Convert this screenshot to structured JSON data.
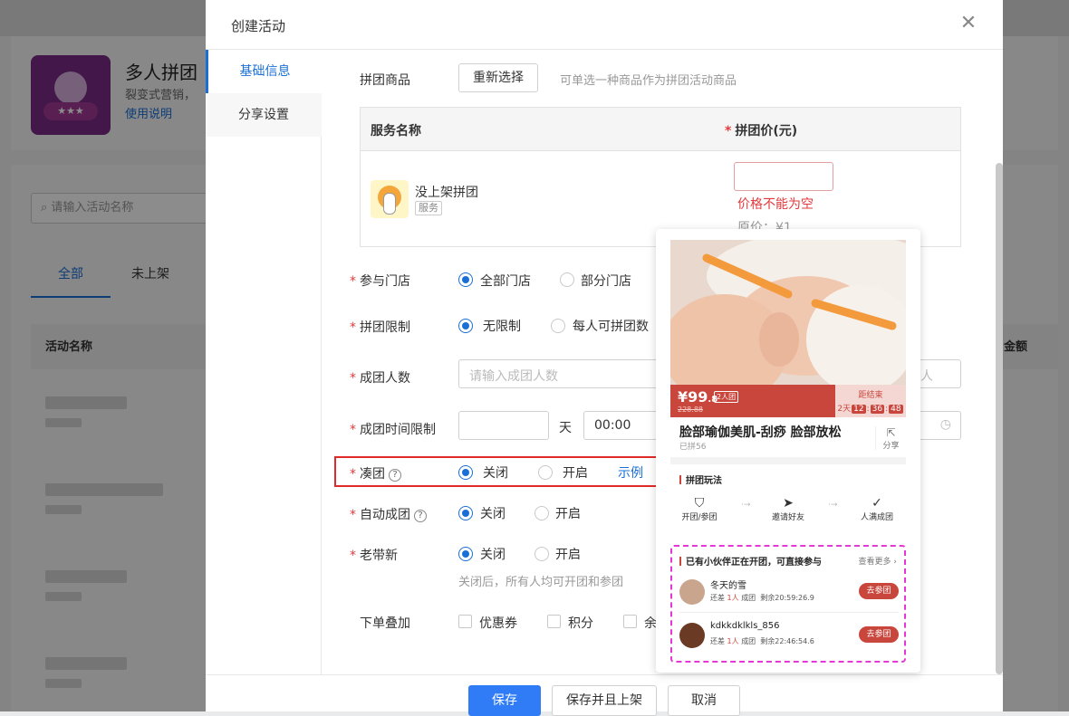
{
  "background": {
    "app_title": "多人拼团",
    "app_desc": "裂变式营销，",
    "app_link": "使用说明",
    "search_placeholder": "请输入活动名称",
    "tabs": [
      "全部",
      "未上架"
    ],
    "col_name": "活动名称",
    "col_amount": "金额"
  },
  "modal": {
    "title": "创建活动",
    "close": "✕",
    "side_tabs": [
      "基础信息",
      "分享设置"
    ],
    "product": {
      "label": "拼团商品",
      "reselect": "重新选择",
      "hint": "可单选一种商品作为拼团活动商品",
      "col_service": "服务名称",
      "col_price": "拼团价(元)",
      "item_name": "没上架拼团",
      "item_tag": "服务",
      "price_error": "价格不能为空",
      "orig_price": "原价：¥1"
    },
    "stores": {
      "label": "参与门店",
      "opt1": "全部门店",
      "opt2": "部分门店"
    },
    "limit": {
      "label": "拼团限制",
      "opt1": "无限制",
      "opt2": "每人可拼团数"
    },
    "size": {
      "label": "成团人数",
      "placeholder": "请输入成团人数",
      "unit": "人"
    },
    "time": {
      "label": "成团时间限制",
      "day_unit": "天",
      "time_value": "00:00"
    },
    "combine": {
      "label": "凑团",
      "opt1": "关闭",
      "opt2": "开启",
      "example": "示例"
    },
    "auto": {
      "label": "自动成团",
      "opt1": "关闭",
      "opt2": "开启"
    },
    "oldnew": {
      "label": "老带新",
      "opt1": "关闭",
      "opt2": "开启",
      "note": "关闭后，所有人均可开团和参团"
    },
    "stack": {
      "label": "下单叠加",
      "opt1": "优惠券",
      "opt2": "积分",
      "opt3": "余"
    },
    "buttons": {
      "save": "保存",
      "save_publish": "保存并且上架",
      "cancel": "取消"
    }
  },
  "preview": {
    "price": "¥99",
    "price_decimal": ".8",
    "orig": "228.88",
    "group_badge": "2人团",
    "countdown_label": "距结束",
    "cd_day": "2天",
    "cd_h": "12",
    "cd_m": "36",
    "cd_s": "48",
    "title": "脸部瑜伽美肌-刮痧 脸部放松",
    "sold": "已拼56",
    "share": "分享",
    "rules_title": "拼团玩法",
    "steps": [
      "开团/参团",
      "邀请好友",
      "人满成团"
    ],
    "join_title": "已有小伙伴正在开团，可直接参与",
    "more": "查看更多 ›",
    "joins": [
      {
        "name": "冬天的雪",
        "info_prefix": "还差",
        "need": "1人",
        "info_mid": "成团",
        "remain": "剩余20:59:26.9",
        "btn": "去参团"
      },
      {
        "name": "kdkkdklkls_856",
        "info_prefix": "还差",
        "need": "1人",
        "info_mid": "成团",
        "remain": "剩余22:46:54.6",
        "btn": "去参团"
      }
    ]
  },
  "colors": {
    "primary": "#1a6fd6",
    "danger": "#e4393c",
    "preview_red": "#c9463d",
    "highlight_box": "#e02a2a",
    "dashed": "#e437d6"
  }
}
